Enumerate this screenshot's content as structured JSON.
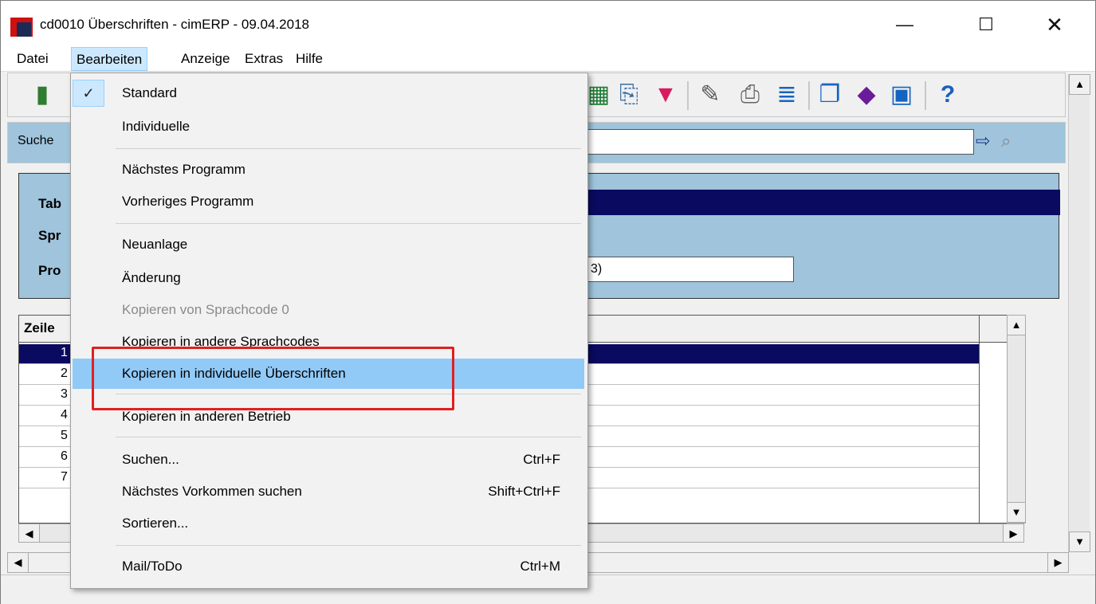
{
  "window": {
    "title": "cd0010 Überschriften - cimERP - 09.04.2018",
    "minimize_glyph": "—",
    "maximize_glyph": "☐",
    "close_glyph": "✕"
  },
  "menubar": {
    "items": [
      "Datei",
      "Bearbeiten",
      "Anzeige",
      "Extras",
      "Hilfe"
    ],
    "active": "Bearbeiten"
  },
  "search": {
    "label": "Suche"
  },
  "form": {
    "labels": [
      "Tab",
      "Spr",
      "Pro"
    ],
    "field_value": "3)"
  },
  "grid": {
    "header_label": "Zeile",
    "rows": [
      "1",
      "2",
      "3",
      "4",
      "5",
      "6",
      "7"
    ]
  },
  "dropdown": {
    "items": [
      {
        "label": "Standard",
        "checked": true
      },
      {
        "label": "Individuelle"
      },
      {
        "label": "Nächstes Programm"
      },
      {
        "label": "Vorheriges Programm"
      },
      {
        "label": "Neuanlage"
      },
      {
        "label": "Änderung"
      },
      {
        "label": "Kopieren von Sprachcode 0",
        "disabled": true
      },
      {
        "label": "Kopieren in andere Sprachcodes"
      },
      {
        "label": "Kopieren in individuelle Überschriften",
        "highlighted": true
      },
      {
        "label": "Kopieren in anderen Betrieb"
      },
      {
        "label": "Suchen...",
        "shortcut": "Ctrl+F"
      },
      {
        "label": "Nächstes Vorkommen suchen",
        "shortcut": "Shift+Ctrl+F"
      },
      {
        "label": "Sortieren..."
      },
      {
        "label": "Mail/ToDo",
        "shortcut": "Ctrl+M"
      }
    ]
  },
  "colors": {
    "highlight": "#91c9f7",
    "panel": "#9fc4dc",
    "selection": "#0a0a60",
    "callout": "#e02020"
  },
  "icons": [
    "door-exit-icon",
    "excel-export-icon",
    "copy-icon",
    "filter-icon",
    "edit-icon",
    "print-icon",
    "data-transfer-icon",
    "windows-icon",
    "book-icon",
    "table-icon",
    "help-icon"
  ]
}
